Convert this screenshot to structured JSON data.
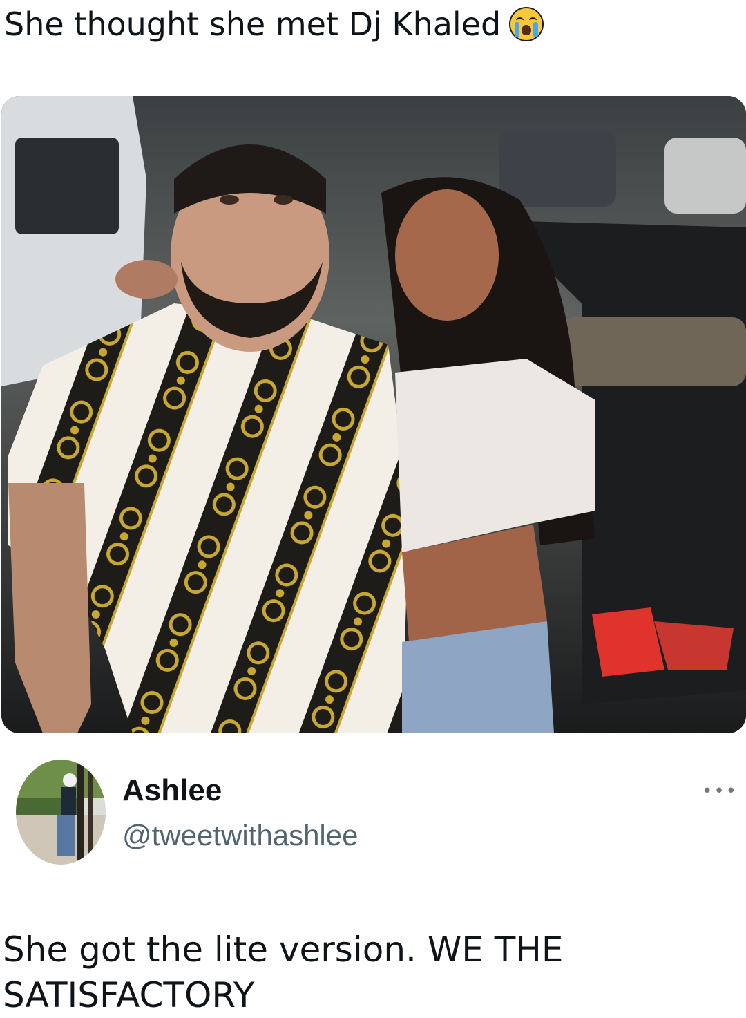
{
  "caption": {
    "text": "She thought she met Dj Khaled",
    "emoji": "loudly-crying-face"
  },
  "post_image": {
    "alt_subjects": [
      "man in black-white-gold chain print shirt",
      "woman in white crop top and jeans"
    ],
    "colors": {
      "shirt_white": "#f3efe6",
      "shirt_black": "#1d1c18",
      "shirt_gold": "#c9a733",
      "background_dark": "#2b2d2e",
      "car_light_red": "#e0332b",
      "jeans": "#8ea6c4"
    }
  },
  "tweet": {
    "avatar_icon": "profile-photo",
    "display_name": "Ashlee",
    "handle": "@tweetwithashlee",
    "more_label": "•••",
    "text": "She got the lite version. WE THE SATISFACTORY"
  },
  "colors": {
    "background": "#ffffff",
    "text_primary": "#0f1419",
    "text_secondary": "#536471"
  }
}
